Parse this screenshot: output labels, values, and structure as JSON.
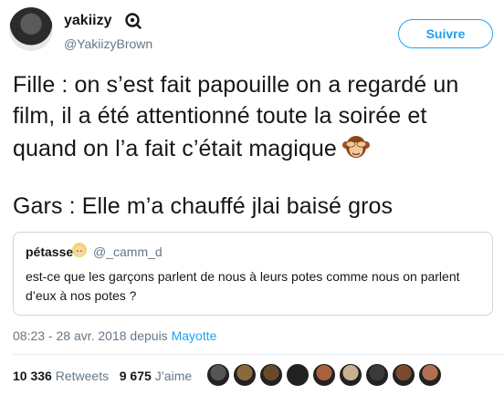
{
  "user": {
    "display_name": "yakiizy",
    "handle": "@YakiizyBrown"
  },
  "follow_button": {
    "label": "Suivre"
  },
  "tweet": {
    "lines": [
      "Fille : on s’est fait papouille on a regardé un",
      "film, il a été attentionné toute la soirée et",
      "quand on l’a fait c’était magique",
      "Gars : Elle m’a chauffé jlai baisé gros"
    ],
    "emoji": "see-no-evil-monkey-icon"
  },
  "quoted_tweet": {
    "name": "pétasse",
    "handle": "@_camm_d",
    "text": "est-ce que les garçons parlent de nous à leurs potes comme nous on parlent d’eux à nos potes ?",
    "emoji": "blonde-person-icon"
  },
  "meta": {
    "time": "08:23 - 28 avr. 2018 depuis",
    "location": "Mayotte"
  },
  "stats": {
    "retweets_count": "10 336",
    "retweets_label": "Retweets",
    "likes_count": "9 675",
    "likes_label": "J’aime"
  },
  "likers": [
    "#555555",
    "#8a6a3a",
    "#6b4a2a",
    "#222222",
    "#a86040",
    "#c9b090",
    "#3a3a3a",
    "#7a4a30",
    "#b07050"
  ]
}
